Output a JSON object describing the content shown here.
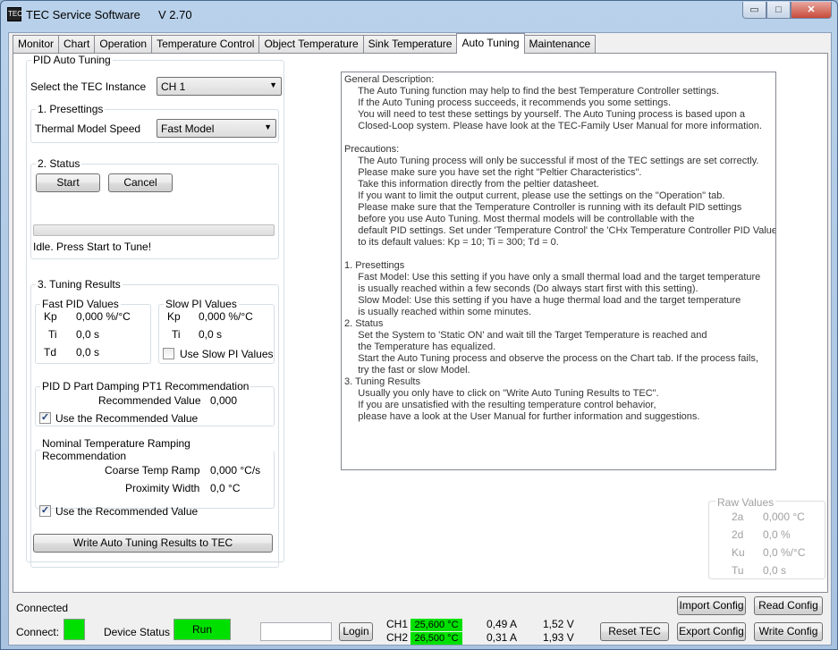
{
  "window": {
    "icon_text": "TEC",
    "title": "TEC Service Software",
    "version": "V 2.70",
    "buttons": {
      "minimize": "▭",
      "maximize": "□",
      "close": "✕"
    }
  },
  "tabs": [
    {
      "label": "Monitor"
    },
    {
      "label": "Chart"
    },
    {
      "label": "Operation"
    },
    {
      "label": "Temperature Control"
    },
    {
      "label": "Object Temperature"
    },
    {
      "label": "Sink Temperature"
    },
    {
      "label": "Auto Tuning",
      "active": true
    },
    {
      "label": "Maintenance"
    }
  ],
  "pid": {
    "group_title": "PID Auto Tuning",
    "instance_label": "Select the TEC Instance",
    "instance_value": "CH 1",
    "presettings": {
      "title": "1. Presettings",
      "speed_label": "Thermal Model Speed",
      "speed_value": "Fast Model"
    },
    "status": {
      "title": "2. Status",
      "start_label": "Start",
      "cancel_label": "Cancel",
      "progress": 0,
      "status_text": "Idle. Press Start to Tune!"
    },
    "results": {
      "title": "3. Tuning Results",
      "fast": {
        "title": "Fast PID Values",
        "kp_label": "Kp",
        "kp_value": "0,000 %/°C",
        "ti_label": "Ti",
        "ti_value": "0,0 s",
        "td_label": "Td",
        "td_value": "0,0 s"
      },
      "slow": {
        "title": "Slow PI Values",
        "kp_label": "Kp",
        "kp_value": "0,000 %/°C",
        "ti_label": "Ti",
        "ti_value": "0,0 s",
        "use_label": "Use Slow PI Values",
        "use_checked": false
      },
      "damping": {
        "title": "PID D Part Damping PT1 Recommendation",
        "rec_label": "Recommended Value",
        "rec_value": "0,000",
        "use_label": "Use the Recommended Value",
        "use_checked": true
      },
      "ramping": {
        "title": "Nominal Temperature Ramping Recommendation",
        "coarse_label": "Coarse Temp Ramp",
        "coarse_value": "0,000 °C/s",
        "proximity_label": "Proximity Width",
        "proximity_value": "0,0 °C",
        "use_label": "Use the Recommended Value",
        "use_checked": true
      },
      "write_label": "Write Auto Tuning Results to TEC"
    }
  },
  "description": "General Description:\n     The Auto Tuning function may help to find the best Temperature Controller settings.\n     If the Auto Tuning process succeeds, it recommends you some settings.\n     You will need to test these settings by yourself. The Auto Tuning process is based upon a\n     Closed-Loop system. Please have look at the TEC-Family User Manual for more information.\n\nPrecautions:\n     The Auto Tuning process will only be successful if most of the TEC settings are set correctly.\n     Please make sure you have set the right \"Peltier Characteristics\".\n     Take this information directly from the peltier datasheet.\n     If you want to limit the output current, please use the settings on the \"Operation\" tab.\n     Please make sure that the Temperature Controller is running with its default PID settings\n     before you use Auto Tuning. Most thermal models will be controllable with the\n     default PID settings. Set under 'Temperature Control' the 'CHx Temperature Controller PID Values'\n     to its default values: Kp = 10; Ti = 300; Td = 0.\n\n1. Presettings\n     Fast Model: Use this setting if you have only a small thermal load and the target temperature\n     is usually reached within a few seconds (Do always start first with this setting).\n     Slow Model: Use this setting if you have a huge thermal load and the target temperature\n     is usually reached within some minutes.\n2. Status\n     Set the System to 'Static ON' and wait till the Target Temperature is reached and\n     the Temperature has equalized.\n     Start the Auto Tuning process and observe the process on the Chart tab. If the process fails,\n     try the fast or slow Model.\n3. Tuning Results\n     Usually you only have to click on \"Write Auto Tuning Results to TEC\".\n     If you are unsatisfied with the resulting temperature control behavior,\n     please have a look at the User Manual for further information and suggestions.",
  "raw_values": {
    "title": "Raw Values",
    "rows": [
      {
        "label": "2a",
        "value": "0,000 °C"
      },
      {
        "label": "2d",
        "value": "0,0 %"
      },
      {
        "label": "Ku",
        "value": "0,0 %/°C"
      },
      {
        "label": "Tu",
        "value": "0,0 s"
      }
    ]
  },
  "footer": {
    "connected_text": "Connected",
    "connect_label": "Connect:",
    "device_status_label": "Device Status",
    "device_status_value": "Run",
    "login_label": "Login",
    "ch1": {
      "label": "CH1",
      "temp": "25,600 °C",
      "current": "0,49 A",
      "voltage": "1,52 V"
    },
    "ch2": {
      "label": "CH2",
      "temp": "26,500 °C",
      "current": "0,31 A",
      "voltage": "1,93 V"
    },
    "reset_label": "Reset TEC",
    "import_label": "Import Config",
    "export_label": "Export Config",
    "read_label": "Read Config",
    "write_label": "Write Config"
  },
  "colors": {
    "status_green": "#00e000",
    "window_frame": "#b9d1ea"
  }
}
